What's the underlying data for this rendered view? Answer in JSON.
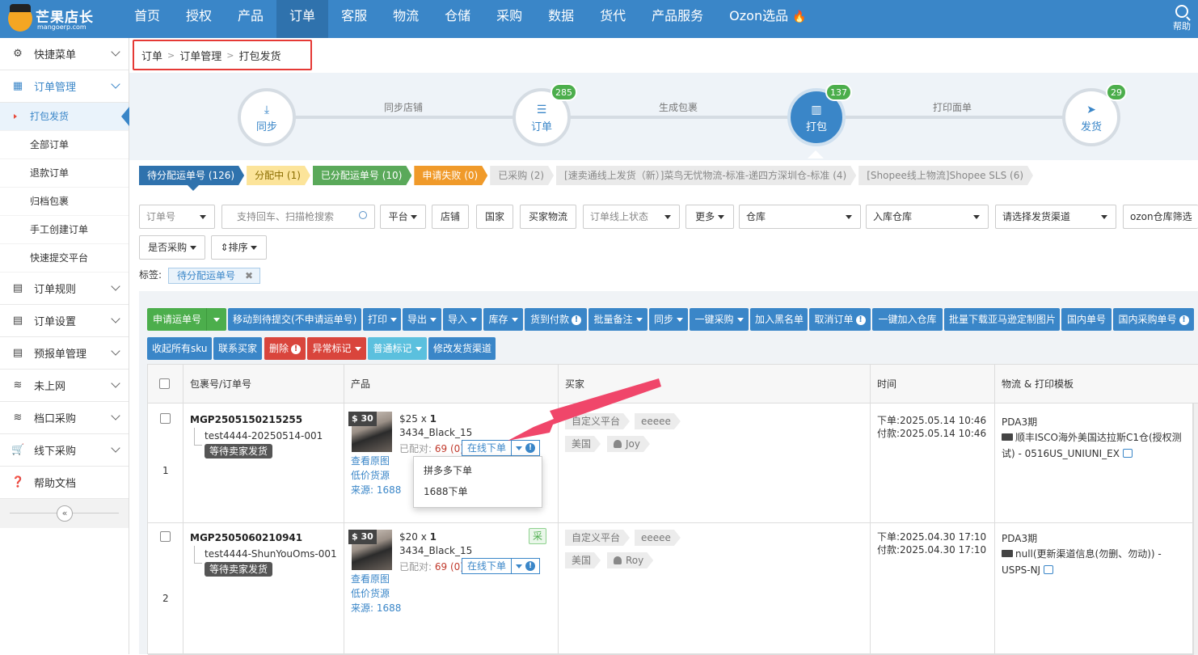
{
  "brand": {
    "name": "芒果店长",
    "sub": "mangoerp.com"
  },
  "nav": [
    "首页",
    "授权",
    "产品",
    "订单",
    "客服",
    "物流",
    "仓储",
    "采购",
    "数据",
    "货代",
    "产品服务",
    "Ozon选品"
  ],
  "nav_active": "订单",
  "help": "帮助",
  "sidebar": {
    "sections": [
      {
        "label": "快捷菜单",
        "icon": "gear-icon"
      },
      {
        "label": "订单管理",
        "icon": "order-icon",
        "open": true,
        "items": [
          "打包发货",
          "全部订单",
          "退款订单",
          "归档包裹",
          "手工创建订单",
          "快速提交平台"
        ]
      },
      {
        "label": "订单规则",
        "icon": "rule-icon"
      },
      {
        "label": "订单设置",
        "icon": "settings-icon"
      },
      {
        "label": "预报单管理",
        "icon": "forecast-icon"
      },
      {
        "label": "未上网",
        "icon": "wifi-icon"
      },
      {
        "label": "档口采购",
        "icon": "wifi-icon"
      },
      {
        "label": "线下采购",
        "icon": "cart-icon"
      },
      {
        "label": "帮助文档",
        "icon": "help-icon"
      }
    ],
    "current": "打包发货"
  },
  "breadcrumb": [
    "订单",
    "订单管理",
    "打包发货"
  ],
  "steps": [
    {
      "label": "同步",
      "badge": ""
    },
    {
      "label": "订单",
      "badge": "285"
    },
    {
      "label": "打包",
      "badge": "137"
    },
    {
      "label": "发货",
      "badge": "29"
    }
  ],
  "step_links": [
    "同步店铺",
    "生成包裹",
    "打印面单"
  ],
  "status_tabs": [
    "待分配运单号 (126)",
    "分配中 (1)",
    "已分配运单号 (10)",
    "申请失败 (0)",
    "已采购 (2)",
    "[速卖通线上发货（新）]菜鸟无忧物流-标准-递四方深圳仓-标准 (4)",
    "[Shopee线上物流]Shopee SLS (6)"
  ],
  "filters": {
    "order_no": "订单号",
    "search_placeholder": "支持回车、扫描枪搜索",
    "platform": "平台",
    "shop": "店铺",
    "country": "国家",
    "buyer_logistics": "买家物流",
    "online_status": "订单线上状态",
    "more": "更多",
    "warehouse": "仓库",
    "in_warehouse": "入库仓库",
    "channel": "请选择发货渠道",
    "ozon": "ozon仓库筛选",
    "purchased": "是否采购",
    "sort": "排序"
  },
  "tag_label": "标签:",
  "tag_chip": "待分配运单号",
  "actions": {
    "row1": [
      "申请运单号",
      "移动到待提交(不申请运单号)",
      "打印",
      "导出",
      "导入",
      "库存",
      "货到付款",
      "批量备注",
      "同步",
      "一键采购",
      "加入黑名单",
      "取消订单",
      "一键加入仓库",
      "批量下载亚马逊定制图片",
      "国内单号",
      "国内采购单号"
    ],
    "row2": [
      "收起所有sku",
      "联系买家",
      "删除",
      "异常标记",
      "普通标记",
      "修改发货渠道"
    ]
  },
  "table": {
    "headers": [
      "包裹号/订单号",
      "产品",
      "买家",
      "时间",
      "物流 & 打印模板"
    ],
    "rows": [
      {
        "index": "1",
        "pkg": "MGP2505150215255",
        "order": "test4444-20250514-001",
        "status": "等待卖家发货",
        "price_tag": "$ 30",
        "price": "$25",
        "qty_x": "x",
        "qty": "1",
        "sku": "3434_Black_15",
        "matched_label": "已配对:",
        "matched": "69 (0)",
        "online_btn": "在线下单",
        "links": [
          "查看原图",
          "低价货源",
          "来源: 1688"
        ],
        "platform": "自定义平台",
        "buyer_id": "eeeee",
        "country": "美国",
        "buyer": "Joy",
        "order_time": "下单:2025.05.14 10:46",
        "pay_time": "付款:2025.05.14 10:46",
        "pda": "PDA3期",
        "logistics": "顺丰ISCO海外美国达拉斯C1仓(授权测试) - 0516US_UNIUNI_EX",
        "cai": ""
      },
      {
        "index": "2",
        "pkg": "MGP2505060210941",
        "order": "test4444-ShunYouOms-001",
        "status": "等待卖家发货",
        "price_tag": "$ 30",
        "price": "$20",
        "qty_x": "x",
        "qty": "1",
        "sku": "3434_Black_15",
        "matched_label": "已配对:",
        "matched": "69 (0)",
        "online_btn": "在线下单",
        "links": [
          "查看原图",
          "低价货源",
          "来源: 1688"
        ],
        "platform": "自定义平台",
        "buyer_id": "eeeee",
        "country": "美国",
        "buyer": "Roy",
        "order_time": "下单:2025.04.30 17:10",
        "pay_time": "付款:2025.04.30 17:10",
        "pda": "PDA3期",
        "logistics": "null(更新渠道信息(勿删、勿动)) - USPS-NJ",
        "cai": "采"
      }
    ]
  },
  "dropdown": [
    "拼多多下单",
    "1688下单"
  ],
  "colors": {
    "nav": "#3a86c8",
    "annotation_arrow": "#f0466a",
    "highlight_box": "#e53935"
  }
}
